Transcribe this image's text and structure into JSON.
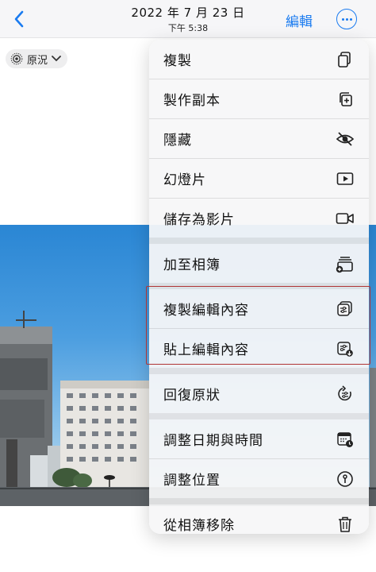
{
  "header": {
    "back_icon": "chevron-left-icon",
    "date": "2022 年 7 月 23 日",
    "time": "下午 5:38",
    "edit_label": "編輯",
    "more_icon": "ellipsis-circle-icon"
  },
  "live_photo": {
    "label": "原況",
    "icon": "live-photo-icon"
  },
  "menu": {
    "items": [
      {
        "label": "複製",
        "icon": "copy-icon"
      },
      {
        "label": "製作副本",
        "icon": "duplicate-icon"
      },
      {
        "label": "隱藏",
        "icon": "eye-slash-icon"
      },
      {
        "label": "幻燈片",
        "icon": "play-rectangle-icon"
      },
      {
        "label": "儲存為影片",
        "icon": "video-icon"
      },
      {
        "label": "加至相簿",
        "icon": "add-to-album-icon"
      },
      {
        "label": "複製編輯內容",
        "icon": "copy-edits-icon"
      },
      {
        "label": "貼上編輯內容",
        "icon": "paste-edits-icon"
      },
      {
        "label": "回復原狀",
        "icon": "revert-icon"
      },
      {
        "label": "調整日期與時間",
        "icon": "calendar-clock-icon"
      },
      {
        "label": "調整位置",
        "icon": "location-info-icon"
      },
      {
        "label": "從相簿移除",
        "icon": "trash-icon"
      }
    ]
  },
  "colors": {
    "accent": "#1a7bf0",
    "highlight_border": "#b03434"
  }
}
